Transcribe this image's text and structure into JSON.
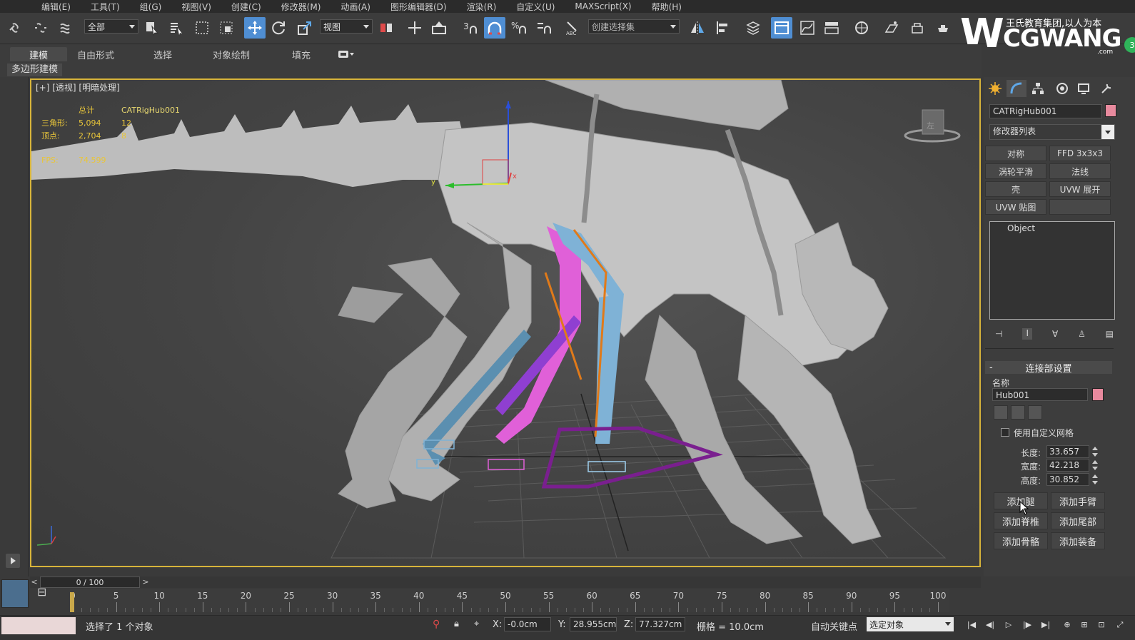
{
  "menu": [
    "编辑(E)",
    "工具(T)",
    "组(G)",
    "视图(V)",
    "创建(C)",
    "修改器(M)",
    "动画(A)",
    "图形编辑器(D)",
    "渲染(R)",
    "自定义(U)",
    "MAXScript(X)",
    "帮助(H)"
  ],
  "toolbar": {
    "selection_filter": "全部",
    "ref_coord": "视图",
    "named_selection_placeholder": "创建选择集"
  },
  "logo": {
    "tagline": "王氏教育集团,以人为本",
    "brand": "CGWANG",
    "domain": ".com",
    "badge": "3"
  },
  "ribbon": {
    "tabs": [
      "建模",
      "自由形式",
      "选择",
      "对象绘制",
      "填充"
    ],
    "active_tab": "建模",
    "sub_label": "多边形建模"
  },
  "viewport": {
    "label": "[+] [透视] [明暗处理]",
    "stats": {
      "header_total": "总计",
      "header_object": "CATRigHub001",
      "triangles_label": "三角形:",
      "triangles_total": "5,094",
      "triangles_object": "12",
      "vertices_label": "顶点:",
      "vertices_total": "2,704",
      "vertices_object": "8",
      "fps_label": "FPS:",
      "fps_value": "74.599"
    },
    "viewcube_label": "左"
  },
  "command_panel": {
    "object_name": "CATRigHub001",
    "modifier_list": "修改器列表",
    "modifier_buttons": [
      "对称",
      "FFD 3x3x3",
      "涡轮平滑",
      "法线",
      "壳",
      "UVW 展开",
      "UVW 贴图",
      ""
    ],
    "stack_items": [
      "Object"
    ],
    "rollout_title": "连接部设置",
    "name_label": "名称",
    "hub_name": "Hub001",
    "use_custom_mesh": "使用自定义网格",
    "length_label": "长度:",
    "length_value": "33.657",
    "width_label": "宽度:",
    "width_value": "42.218",
    "height_label": "高度:",
    "height_value": "30.852",
    "action_buttons": [
      "添加腿",
      "添加手臂",
      "添加脊椎",
      "添加尾部",
      "添加骨骼",
      "添加装备"
    ]
  },
  "timeline": {
    "position": "0 / 100",
    "ticks": [
      "0",
      "5",
      "10",
      "15",
      "20",
      "25",
      "30",
      "35",
      "40",
      "45",
      "50",
      "55",
      "60",
      "65",
      "70",
      "75",
      "80",
      "85",
      "90",
      "95",
      "100"
    ],
    "frame_range_max": 100
  },
  "status": {
    "selection_text": "选择了 1 个对象",
    "x_label": "X:",
    "x_value": "-0.0cm",
    "y_label": "Y:",
    "y_value": "28.955cm",
    "z_label": "Z:",
    "z_value": "77.327cm",
    "grid": "栅格 = 10.0cm",
    "auto_key": "自动关键点",
    "key_set": "选定对象"
  },
  "colors": {
    "viewport_border": "#d7b43a",
    "active_blue": "#4f8ed3",
    "stats_yellow": "#e8c53a",
    "object_color": "#e88a9e",
    "leg_blue": "#7fb2d6",
    "leg_magenta": "#e060d8",
    "leg_purple": "#8f3fd1",
    "leg_orange": "#e07a1a",
    "hub_purple": "#7a1f8f"
  }
}
